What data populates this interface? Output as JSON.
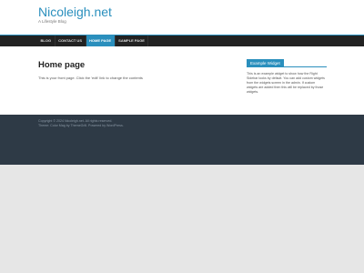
{
  "header": {
    "site_title": "Nicoleigh.net",
    "site_description": "A Lifestyle Blog"
  },
  "nav": {
    "items": [
      {
        "label": "BLOG"
      },
      {
        "label": "CONTACT US"
      },
      {
        "label": "HOME PAGE"
      },
      {
        "label": "SAMPLE PAGE"
      }
    ],
    "active_index": 2
  },
  "main": {
    "title": "Home page",
    "text": "This is your front page. Click the 'edit' link to change the contents"
  },
  "sidebar": {
    "widget_title": "Example Widget",
    "widget_text": "This is an example widget to show how the Right Sidebar looks by default. You can add custom widgets from the widgets screen in the admin. If custom widgets are added then this will be replaced by those widgets."
  },
  "footer": {
    "copyright": "Copyright © 2024 Nicoleigh.net. All rights reserved.",
    "credits": "Theme: Color Mag by ThemeGrill. Powered by WordPress."
  },
  "colors": {
    "accent": "#2a8fbd",
    "navbar": "#222222",
    "footer": "#2e3a46",
    "page_background": "#e6e6e6"
  }
}
